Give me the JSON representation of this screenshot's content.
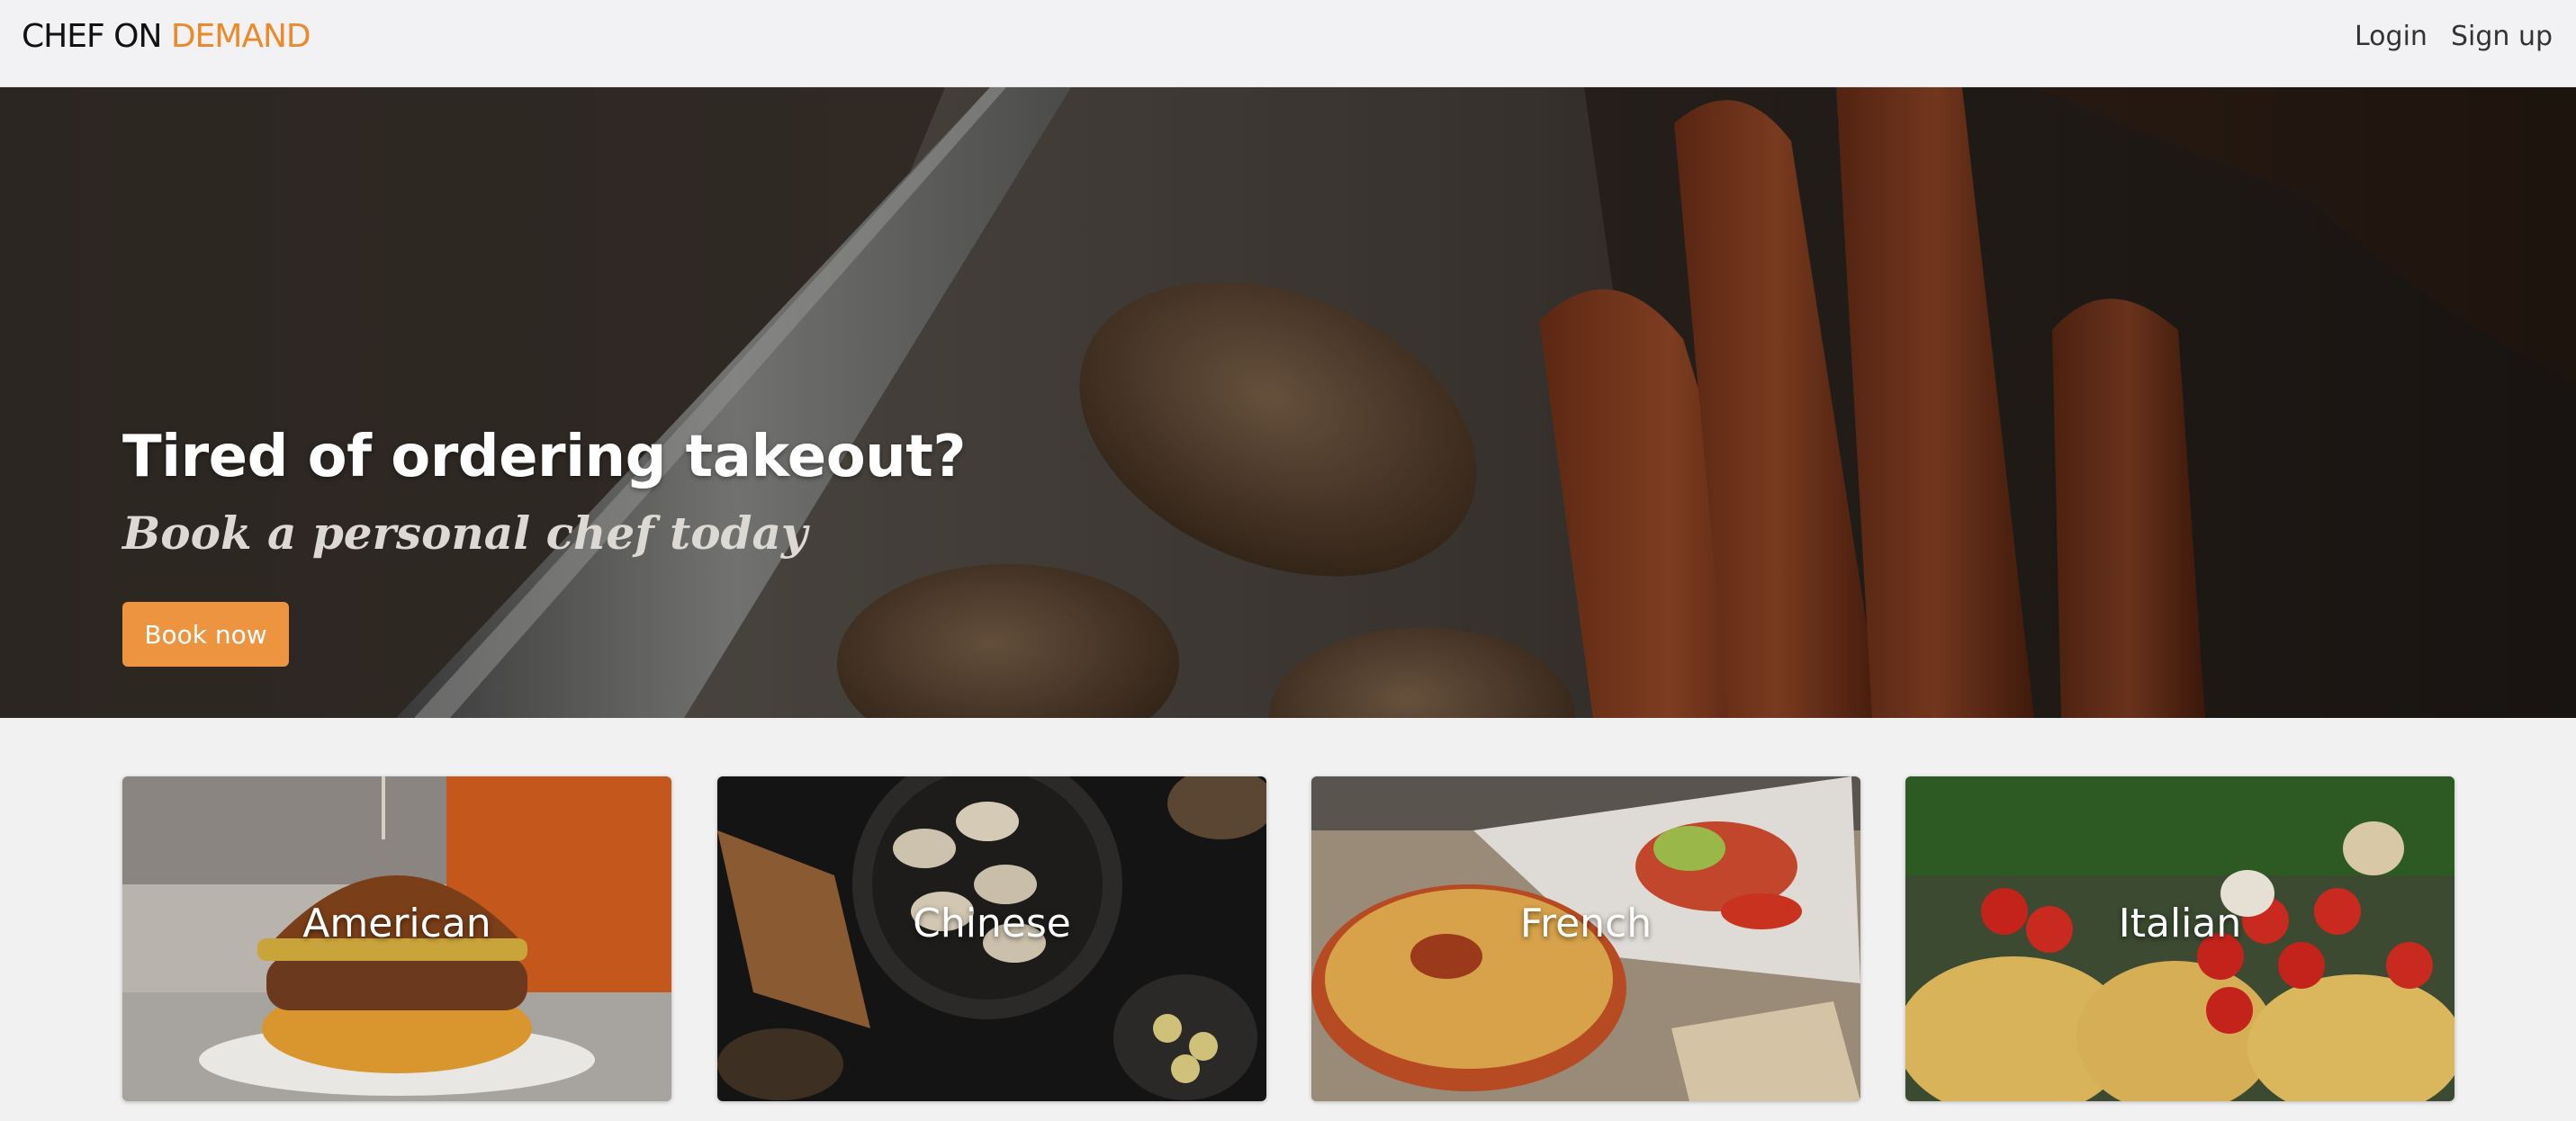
{
  "brand": {
    "prefix": "CHEF ON ",
    "accent": "DEMAND",
    "accent_color": "#ec8a2b"
  },
  "nav": {
    "login_label": "Login",
    "signup_label": "Sign up"
  },
  "hero": {
    "title": "Tired of ordering takeout?",
    "subtitle": "Book a personal chef today",
    "button_label": "Book now",
    "button_color": "#ec9440",
    "image": "knife-potatoes-carrots-photo"
  },
  "categories": [
    {
      "label": "American",
      "image": "burger-photo"
    },
    {
      "label": "Chinese",
      "image": "dumplings-photo"
    },
    {
      "label": "French",
      "image": "quiche-photo"
    },
    {
      "label": "Italian",
      "image": "pasta-tomatoes-photo"
    }
  ]
}
